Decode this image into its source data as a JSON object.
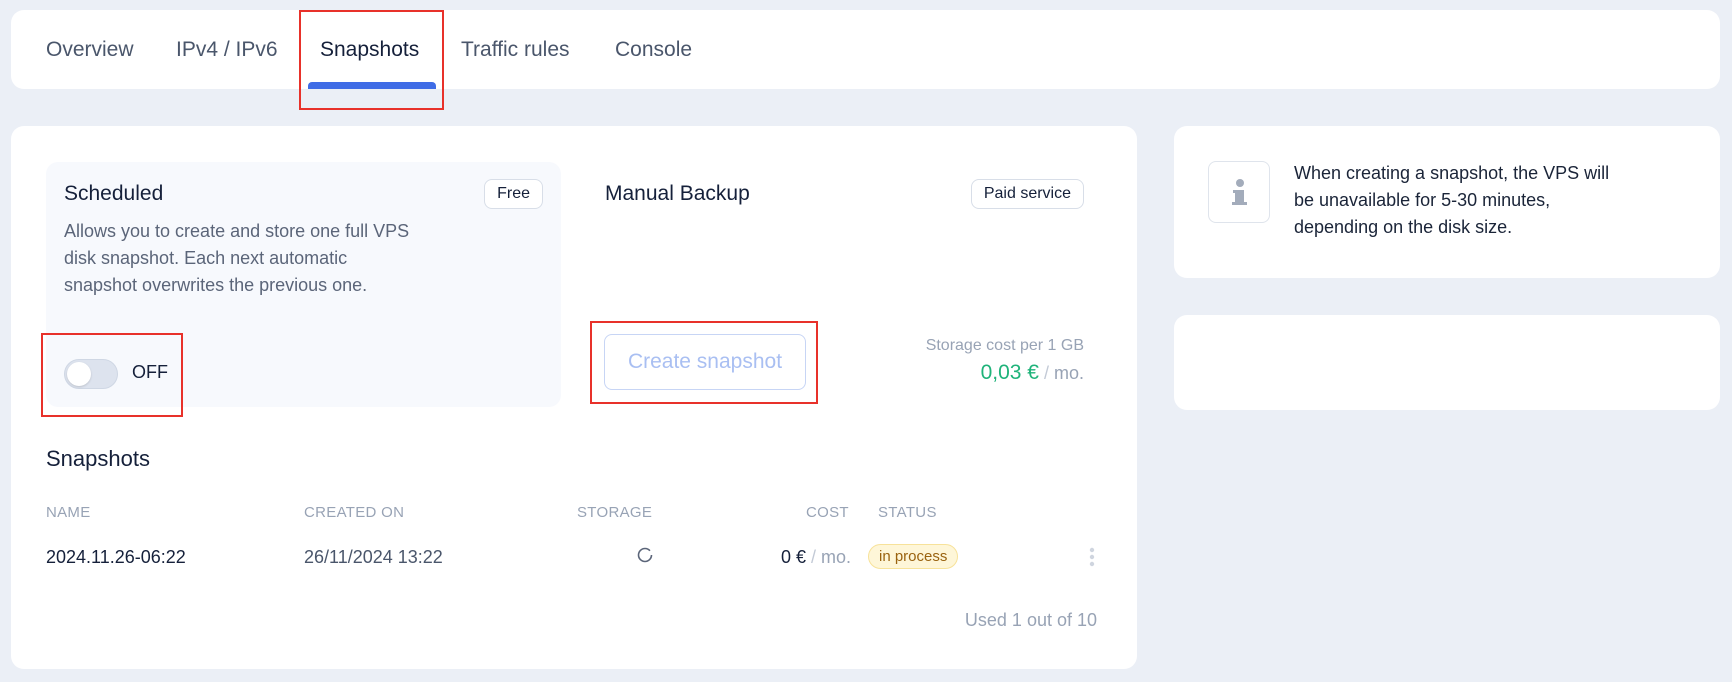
{
  "tabs": [
    {
      "label": "Overview",
      "active": false
    },
    {
      "label": "IPv4 / IPv6",
      "active": false
    },
    {
      "label": "Snapshots",
      "active": true
    },
    {
      "label": "Traffic rules",
      "active": false
    },
    {
      "label": "Console",
      "active": false
    }
  ],
  "scheduled": {
    "title": "Scheduled",
    "badge": "Free",
    "description": "Allows you to create and store one full VPS disk snapshot. Each next automatic snapshot overwrites the previous one.",
    "toggle_state": "OFF"
  },
  "manual": {
    "title": "Manual Backup",
    "badge": "Paid service",
    "create_button": "Create snapshot",
    "cost_label": "Storage cost per 1 GB",
    "cost_value": "0,03 €",
    "cost_unit": "mo."
  },
  "snapshots": {
    "title": "Snapshots",
    "columns": [
      "NAME",
      "CREATED ON",
      "STORAGE",
      "COST",
      "STATUS"
    ],
    "rows": [
      {
        "name": "2024.11.26-06:22",
        "created_on": "26/11/2024 13:22",
        "storage": "loading",
        "cost": "0 €",
        "cost_unit": "mo.",
        "status": "in process"
      }
    ],
    "usage": "Used 1 out of 10"
  },
  "info": {
    "text": "When creating a snapshot, the VPS will be unavailable for 5-30 minutes, depending on the disk size.",
    "icon": "info-icon"
  },
  "colors": {
    "accent": "#3f6ce6",
    "price_green": "#1fb37a",
    "status_bg": "#fef6d8",
    "status_text": "#9a6310",
    "highlight": "#e8312a"
  }
}
